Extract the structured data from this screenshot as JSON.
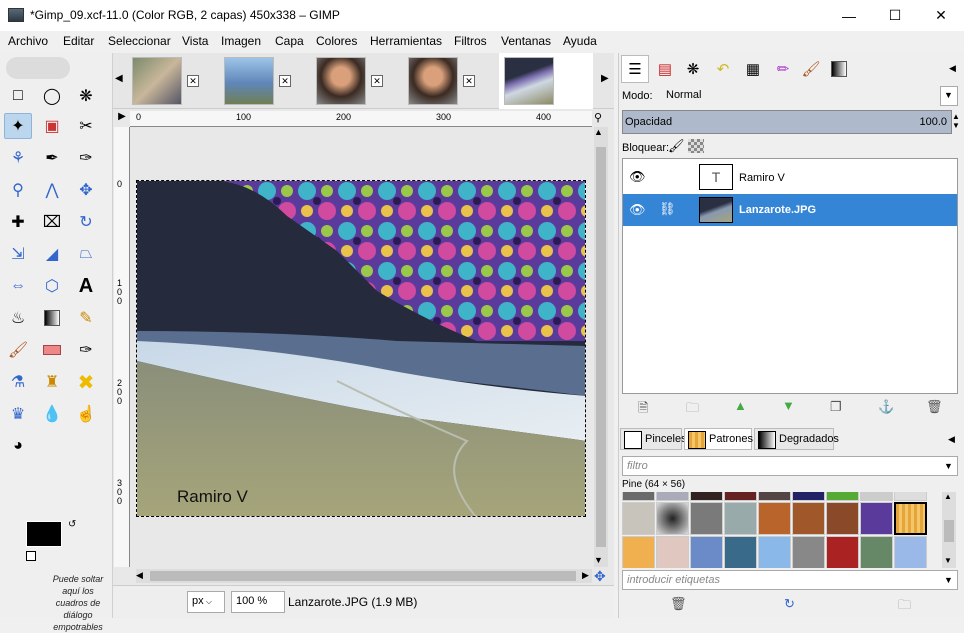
{
  "window": {
    "title": "*Gimp_09.xcf-11.0 (Color RGB, 2 capas) 450x338 – GIMP",
    "minimize_icon": "minimize-icon",
    "maximize_icon": "maximize-icon",
    "close_icon": "close-icon"
  },
  "menu": [
    "Archivo",
    "Editar",
    "Seleccionar",
    "Vista",
    "Imagen",
    "Capa",
    "Colores",
    "Herramientas",
    "Filtros",
    "Ventanas",
    "Ayuda"
  ],
  "toolbox": {
    "drop_hint": "Puede soltar aquí los cuadros de diálogo empotrables"
  },
  "ruler": {
    "top": [
      "0",
      "100",
      "200",
      "300",
      "400"
    ],
    "left": [
      "0",
      "100",
      "200",
      "300"
    ]
  },
  "image": {
    "text_layer": "Ramiro V"
  },
  "status": {
    "unit": "px",
    "zoom": "100 %",
    "info": "Lanzarote.JPG (1.9 MB)"
  },
  "layers": {
    "mode_label": "Modo:",
    "mode_value": "Normal",
    "opacity_label": "Opacidad",
    "opacity_value": "100.0",
    "lock_label": "Bloquear:",
    "items": [
      {
        "name": "Ramiro V",
        "selected": false
      },
      {
        "name": "Lanzarote.JPG",
        "selected": true
      }
    ]
  },
  "resources": {
    "tabs": [
      "Pinceles",
      "Patrones",
      "Degradados"
    ],
    "filter_placeholder": "filtro",
    "pattern_name": "Pine (64 × 56)",
    "tags_placeholder": "introducir etiquetas"
  },
  "colors": {
    "selection": "#3585d6",
    "accent": "#bcd6ee"
  }
}
